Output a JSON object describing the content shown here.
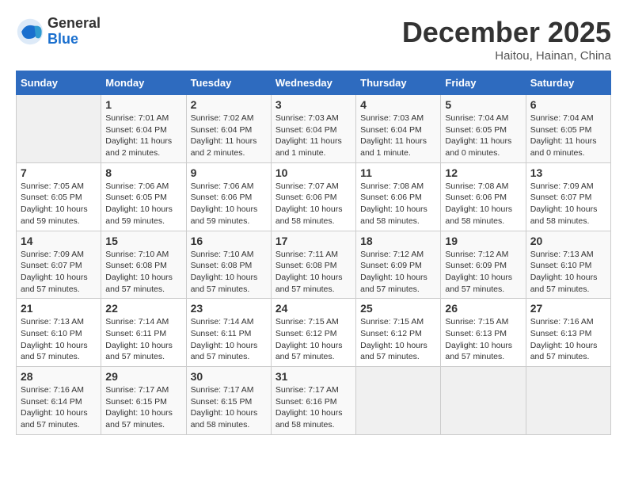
{
  "header": {
    "logo_general": "General",
    "logo_blue": "Blue",
    "month_title": "December 2025",
    "location": "Haitou, Hainan, China"
  },
  "days_of_week": [
    "Sunday",
    "Monday",
    "Tuesday",
    "Wednesday",
    "Thursday",
    "Friday",
    "Saturday"
  ],
  "weeks": [
    [
      {
        "day": "",
        "info": ""
      },
      {
        "day": "1",
        "info": "Sunrise: 7:01 AM\nSunset: 6:04 PM\nDaylight: 11 hours\nand 2 minutes."
      },
      {
        "day": "2",
        "info": "Sunrise: 7:02 AM\nSunset: 6:04 PM\nDaylight: 11 hours\nand 2 minutes."
      },
      {
        "day": "3",
        "info": "Sunrise: 7:03 AM\nSunset: 6:04 PM\nDaylight: 11 hours\nand 1 minute."
      },
      {
        "day": "4",
        "info": "Sunrise: 7:03 AM\nSunset: 6:04 PM\nDaylight: 11 hours\nand 1 minute."
      },
      {
        "day": "5",
        "info": "Sunrise: 7:04 AM\nSunset: 6:05 PM\nDaylight: 11 hours\nand 0 minutes."
      },
      {
        "day": "6",
        "info": "Sunrise: 7:04 AM\nSunset: 6:05 PM\nDaylight: 11 hours\nand 0 minutes."
      }
    ],
    [
      {
        "day": "7",
        "info": "Sunrise: 7:05 AM\nSunset: 6:05 PM\nDaylight: 10 hours\nand 59 minutes."
      },
      {
        "day": "8",
        "info": "Sunrise: 7:06 AM\nSunset: 6:05 PM\nDaylight: 10 hours\nand 59 minutes."
      },
      {
        "day": "9",
        "info": "Sunrise: 7:06 AM\nSunset: 6:06 PM\nDaylight: 10 hours\nand 59 minutes."
      },
      {
        "day": "10",
        "info": "Sunrise: 7:07 AM\nSunset: 6:06 PM\nDaylight: 10 hours\nand 58 minutes."
      },
      {
        "day": "11",
        "info": "Sunrise: 7:08 AM\nSunset: 6:06 PM\nDaylight: 10 hours\nand 58 minutes."
      },
      {
        "day": "12",
        "info": "Sunrise: 7:08 AM\nSunset: 6:06 PM\nDaylight: 10 hours\nand 58 minutes."
      },
      {
        "day": "13",
        "info": "Sunrise: 7:09 AM\nSunset: 6:07 PM\nDaylight: 10 hours\nand 58 minutes."
      }
    ],
    [
      {
        "day": "14",
        "info": "Sunrise: 7:09 AM\nSunset: 6:07 PM\nDaylight: 10 hours\nand 57 minutes."
      },
      {
        "day": "15",
        "info": "Sunrise: 7:10 AM\nSunset: 6:08 PM\nDaylight: 10 hours\nand 57 minutes."
      },
      {
        "day": "16",
        "info": "Sunrise: 7:10 AM\nSunset: 6:08 PM\nDaylight: 10 hours\nand 57 minutes."
      },
      {
        "day": "17",
        "info": "Sunrise: 7:11 AM\nSunset: 6:08 PM\nDaylight: 10 hours\nand 57 minutes."
      },
      {
        "day": "18",
        "info": "Sunrise: 7:12 AM\nSunset: 6:09 PM\nDaylight: 10 hours\nand 57 minutes."
      },
      {
        "day": "19",
        "info": "Sunrise: 7:12 AM\nSunset: 6:09 PM\nDaylight: 10 hours\nand 57 minutes."
      },
      {
        "day": "20",
        "info": "Sunrise: 7:13 AM\nSunset: 6:10 PM\nDaylight: 10 hours\nand 57 minutes."
      }
    ],
    [
      {
        "day": "21",
        "info": "Sunrise: 7:13 AM\nSunset: 6:10 PM\nDaylight: 10 hours\nand 57 minutes."
      },
      {
        "day": "22",
        "info": "Sunrise: 7:14 AM\nSunset: 6:11 PM\nDaylight: 10 hours\nand 57 minutes."
      },
      {
        "day": "23",
        "info": "Sunrise: 7:14 AM\nSunset: 6:11 PM\nDaylight: 10 hours\nand 57 minutes."
      },
      {
        "day": "24",
        "info": "Sunrise: 7:15 AM\nSunset: 6:12 PM\nDaylight: 10 hours\nand 57 minutes."
      },
      {
        "day": "25",
        "info": "Sunrise: 7:15 AM\nSunset: 6:12 PM\nDaylight: 10 hours\nand 57 minutes."
      },
      {
        "day": "26",
        "info": "Sunrise: 7:15 AM\nSunset: 6:13 PM\nDaylight: 10 hours\nand 57 minutes."
      },
      {
        "day": "27",
        "info": "Sunrise: 7:16 AM\nSunset: 6:13 PM\nDaylight: 10 hours\nand 57 minutes."
      }
    ],
    [
      {
        "day": "28",
        "info": "Sunrise: 7:16 AM\nSunset: 6:14 PM\nDaylight: 10 hours\nand 57 minutes."
      },
      {
        "day": "29",
        "info": "Sunrise: 7:17 AM\nSunset: 6:15 PM\nDaylight: 10 hours\nand 57 minutes."
      },
      {
        "day": "30",
        "info": "Sunrise: 7:17 AM\nSunset: 6:15 PM\nDaylight: 10 hours\nand 58 minutes."
      },
      {
        "day": "31",
        "info": "Sunrise: 7:17 AM\nSunset: 6:16 PM\nDaylight: 10 hours\nand 58 minutes."
      },
      {
        "day": "",
        "info": ""
      },
      {
        "day": "",
        "info": ""
      },
      {
        "day": "",
        "info": ""
      }
    ]
  ]
}
